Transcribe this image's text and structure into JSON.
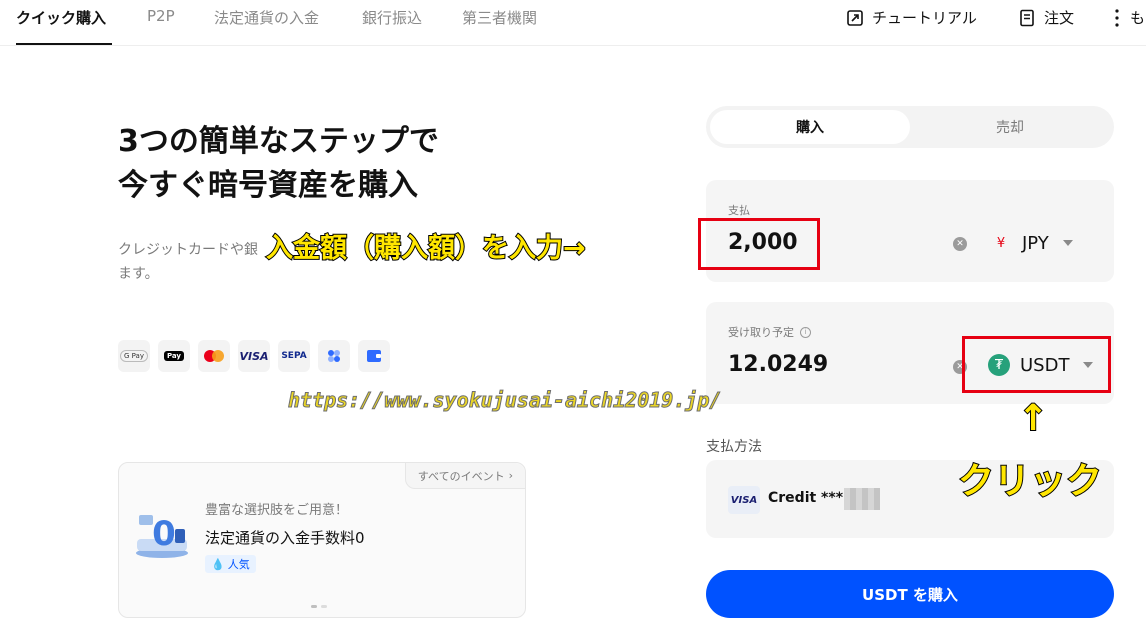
{
  "nav": {
    "tabs": [
      {
        "label": "クイック購入",
        "active": true
      },
      {
        "label": "P2P"
      },
      {
        "label": "法定通貨の入金"
      },
      {
        "label": "銀行振込"
      },
      {
        "label": "第三者機関"
      }
    ],
    "tutorial_label": "チュートリアル",
    "orders_label": "注文",
    "more_label": "も"
  },
  "hero": {
    "title_line1": "3つの簡単なステップで",
    "title_line2": "今すぐ暗号資産を購入",
    "desc_line1": "クレジットカードや銀",
    "desc_line2": "ます。"
  },
  "payment_icons": [
    "G Pay",
    "Apple Pay",
    "Mastercard",
    "VISA",
    "SEPA",
    "pay-app",
    "wallet"
  ],
  "event": {
    "all_events_label": "すべてのイベント",
    "subtitle": "豊富な選択肢をご用意！",
    "title": "法定通貨の入金手数料0",
    "tag": "人気",
    "badge_text": "0"
  },
  "trade": {
    "buy_tab": "購入",
    "sell_tab": "売却",
    "pay_label": "支払",
    "pay_amount": "2,000",
    "pay_currency": "JPY",
    "pay_currency_symbol": "¥",
    "receive_label": "受け取り予定",
    "receive_amount": "12.0249",
    "receive_currency": "USDT",
    "receive_currency_symbol": "₮",
    "payment_method_title": "支払方法",
    "card_brand": "VISA",
    "card_label": "Credit ***",
    "buy_button": "USDT を購入"
  },
  "annotations": {
    "input_hint": "入金額（購入額）を入力→",
    "click_arrow": "↑",
    "click_hint": "クリック",
    "watermark_url": "https://www.syokujusai-aichi2019.jp/"
  },
  "colors": {
    "primary": "#0052ff",
    "highlight_red": "#e60012",
    "annotation_yellow": "#ffe600",
    "usdt_green": "#26a17b"
  }
}
